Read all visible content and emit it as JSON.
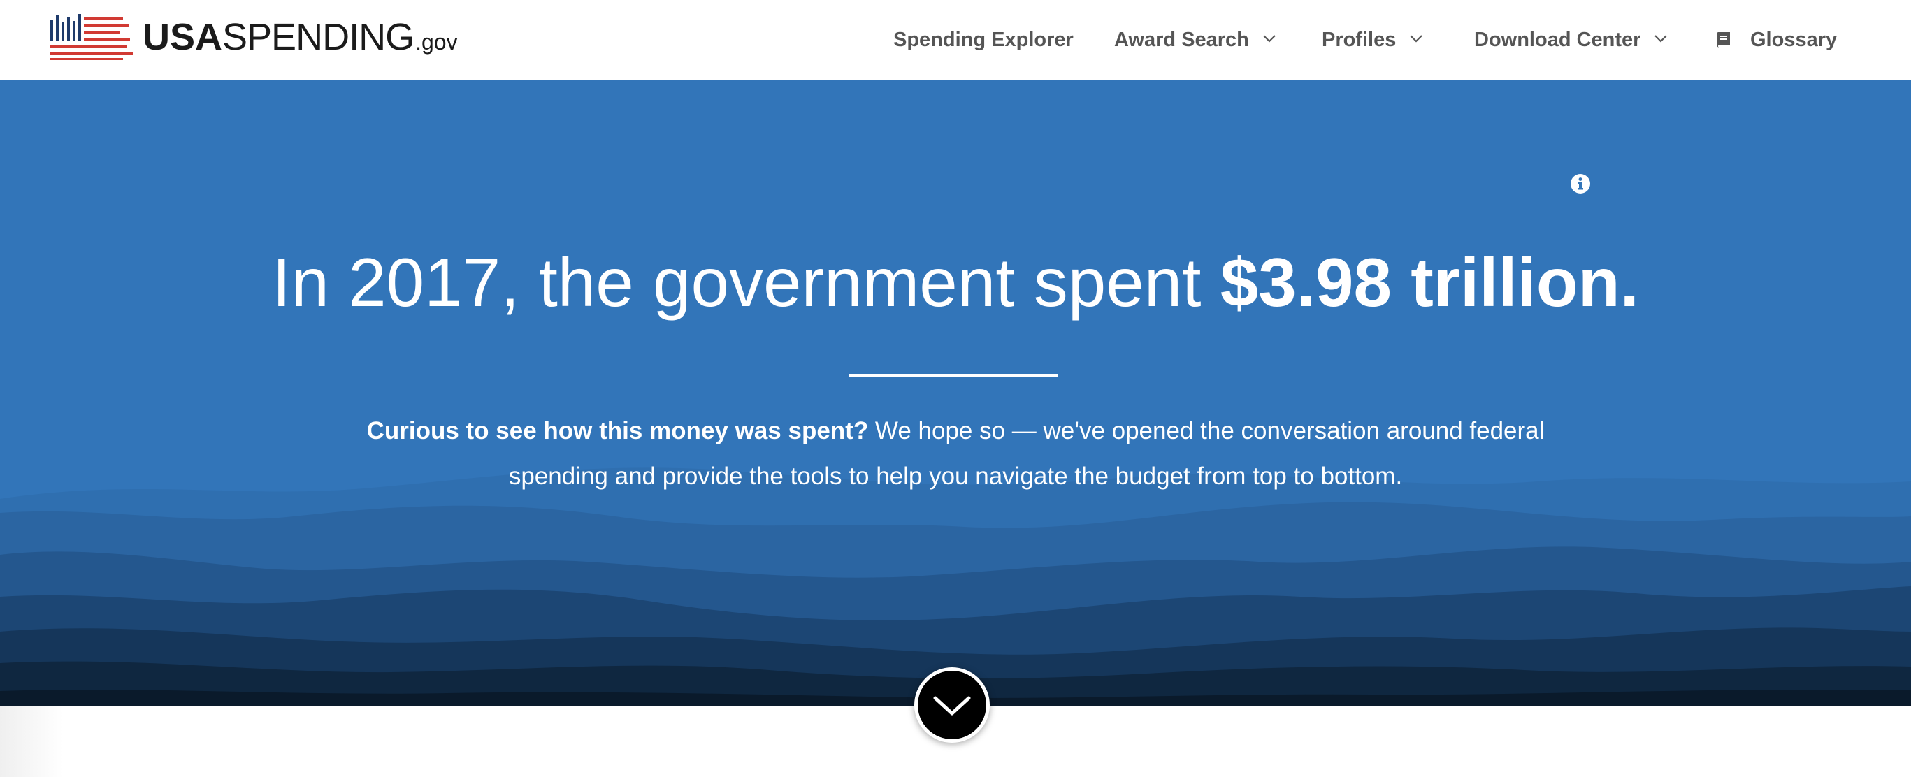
{
  "brand": {
    "logo_bold": "USA",
    "logo_regular": "SPENDING",
    "logo_suffix": ".gov"
  },
  "nav": {
    "items": [
      {
        "label": "Spending Explorer",
        "has_dropdown": false
      },
      {
        "label": "Award Search",
        "has_dropdown": true
      },
      {
        "label": "Profiles",
        "has_dropdown": true
      },
      {
        "label": "Download Center",
        "has_dropdown": true
      },
      {
        "label": "Glossary",
        "icon": "book-icon"
      }
    ]
  },
  "hero": {
    "headline_prefix": "In 2017, the government spent ",
    "headline_amount": "$3.98 trillion.",
    "info_icon": "info-icon",
    "subtext_lead": "Curious to see how this money was spent?",
    "subtext_body": " We hope so — we've opened the conversation around federal spending and provide the tools to help you navigate the budget from top to bottom.",
    "scroll_icon": "chevron-down-icon"
  },
  "colors": {
    "hero_blue": "#3275b9",
    "nav_text": "#555555",
    "logo_red": "#d13a33",
    "logo_navy": "#1f3b6b"
  }
}
